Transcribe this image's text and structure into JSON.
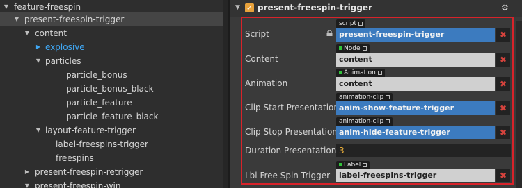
{
  "hierarchy": {
    "nodes": [
      {
        "label": "feature-freespin",
        "arrow": "▼"
      },
      {
        "label": "present-freespin-trigger",
        "arrow": "▼"
      },
      {
        "label": "content",
        "arrow": "▼"
      },
      {
        "label": "explosive",
        "arrow": "▶"
      },
      {
        "label": "particles",
        "arrow": "▼"
      },
      {
        "label": "particle_bonus",
        "arrow": ""
      },
      {
        "label": "particle_bonus_black",
        "arrow": ""
      },
      {
        "label": "particle_feature",
        "arrow": ""
      },
      {
        "label": "particle_feature_black",
        "arrow": ""
      },
      {
        "label": "layout-feature-trigger",
        "arrow": "▼"
      },
      {
        "label": "label-freespins-trigger",
        "arrow": ""
      },
      {
        "label": "freespins",
        "arrow": ""
      },
      {
        "label": "present-freespin-retrigger",
        "arrow": "▶"
      },
      {
        "label": "present-freespin-win",
        "arrow": "▼"
      }
    ]
  },
  "inspector": {
    "component_title": "present-freespin-trigger",
    "enabled_glyph": "✓",
    "properties": [
      {
        "label": "Script",
        "tag": "script",
        "value": "present-freespin-trigger",
        "clear": "✖"
      },
      {
        "label": "Content",
        "tag": "Node",
        "value": "content",
        "clear": "✖"
      },
      {
        "label": "Animation",
        "tag": "Animation",
        "value": "content",
        "clear": "✖"
      },
      {
        "label": "Clip Start Presentation",
        "tag": "animation-clip",
        "value": "anim-show-feature-trigger",
        "clear": "✖"
      },
      {
        "label": "Clip Stop Presentation",
        "tag": "animation-clip",
        "value": "anim-hide-feature-trigger",
        "clear": "✖"
      },
      {
        "label": "Duration Presentation",
        "value": "3"
      },
      {
        "label": "Lbl Free Spin Trigger",
        "tag": "Label",
        "value": "label-freespins-trigger",
        "clear": "✖"
      }
    ]
  },
  "colors": {
    "highlight_border": "#d8232a",
    "asset_field": "#3c7bbf",
    "node_field": "#d0d0d0",
    "selected_tree_text": "#3fa6f2",
    "enabled_checkbox": "#e8a23b"
  }
}
